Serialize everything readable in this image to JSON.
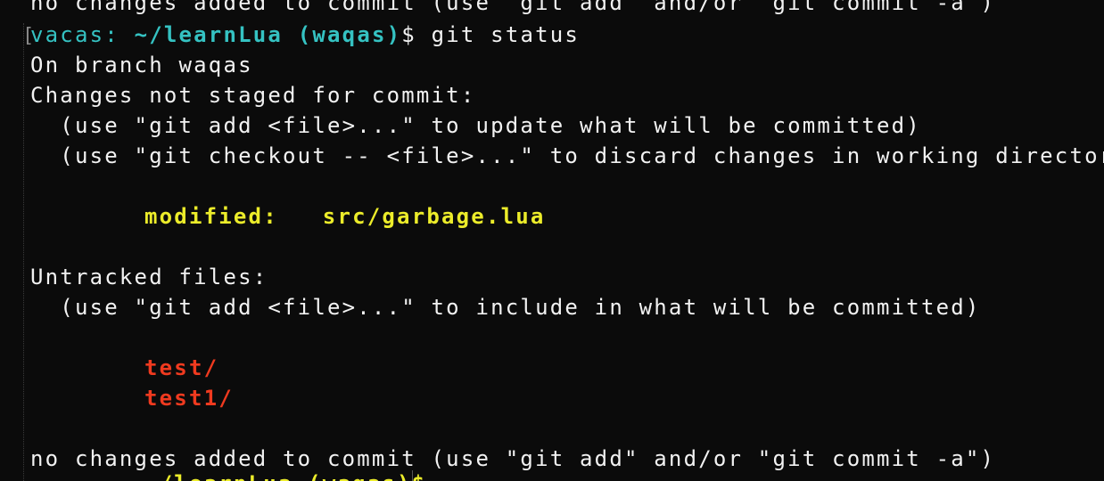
{
  "terminal": {
    "prev_line": "no changes added to commit (use \"git add\" and/or \"git commit -a\")",
    "prompt": {
      "host": "vacas:",
      "path": "~/learnLua",
      "branch": "(waqas)",
      "dollar": "$",
      "command": "git status"
    },
    "output": {
      "branch_line": "On branch waqas",
      "not_staged_header": "Changes not staged for commit:",
      "hint_add": "  (use \"git add <file>...\" to update what will be committed)",
      "hint_checkout": "  (use \"git checkout -- <file>...\" to discard changes in working directory)",
      "modified_label": "modified:",
      "modified_file": "src/garbage.lua",
      "untracked_header": "Untracked files:",
      "hint_untracked": "  (use \"git add <file>...\" to include in what will be committed)",
      "untracked_files": [
        "test/",
        "test1/"
      ],
      "footer": "no changes added to commit (use \"git add\" and/or \"git commit -a\")"
    },
    "next_prompt_partial": "~/learnLua (waqas)$"
  },
  "colors": {
    "background": "#0b0b0b",
    "text": "#f2f2f2",
    "prompt": "#35c2c2",
    "modified": "#ecec2a",
    "untracked": "#f03a1f"
  }
}
